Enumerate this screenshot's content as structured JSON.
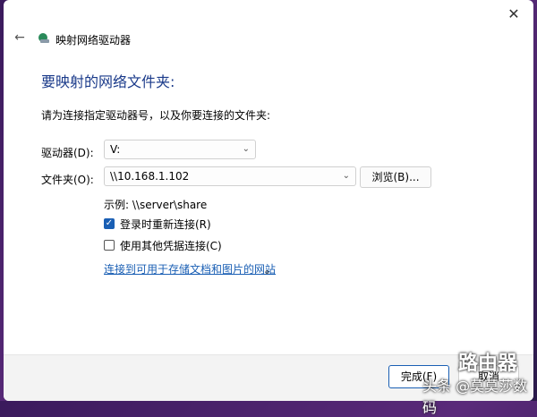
{
  "window": {
    "title": "映射网络驱动器"
  },
  "icons": {
    "close": "close-icon",
    "back": "back-arrow-icon",
    "drive": "network-drive-icon"
  },
  "heading": "要映射的网络文件夹:",
  "instruction": "请为连接指定驱动器号，以及你要连接的文件夹:",
  "drive": {
    "label": "驱动器(D):",
    "value": "V:"
  },
  "folder": {
    "label": "文件夹(O):",
    "value": "\\\\10.168.1.102"
  },
  "browse_label": "浏览(B)...",
  "example": "示例: \\\\server\\share",
  "options": [
    {
      "label": "登录时重新连接(R)",
      "checked": true
    },
    {
      "label": "使用其他凭据连接(C)",
      "checked": false
    }
  ],
  "link": {
    "text": "连接到可用于存储文档和图片的网站",
    "suffix": "。"
  },
  "buttons": {
    "finish": "完成(F)",
    "cancel": "取消"
  },
  "watermark": {
    "brand": "路由器",
    "caption": "头条 @莫莫莎数码"
  }
}
